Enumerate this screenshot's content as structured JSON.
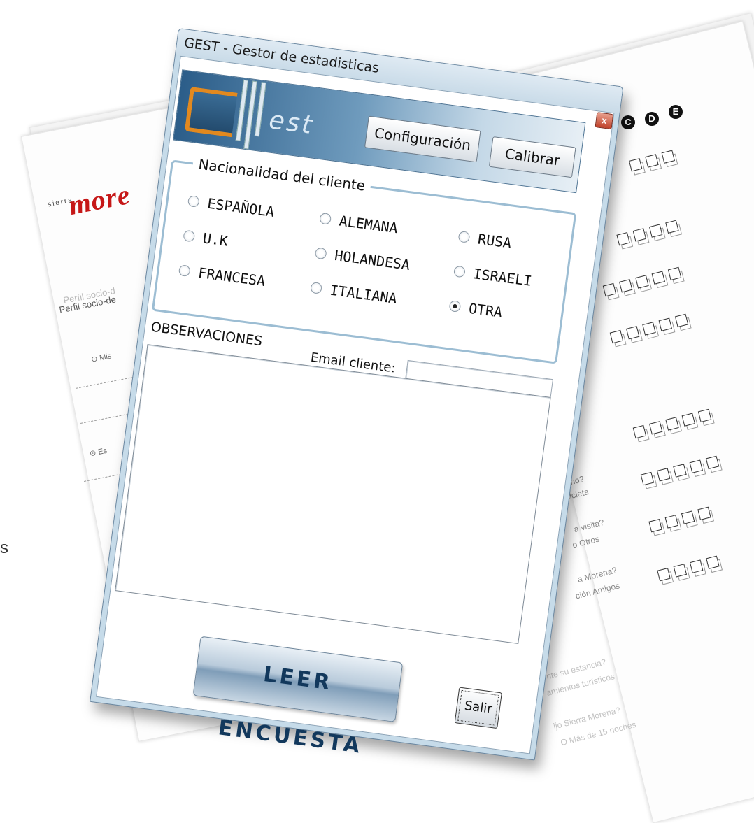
{
  "window": {
    "title": "GEST - Gestor de estadisticas",
    "close_glyph": "x"
  },
  "header": {
    "logo_text": "est",
    "config_label": "Configuración",
    "calibrate_label": "Calibrar"
  },
  "nationality": {
    "legend": "Nacionalidad del cliente",
    "options": [
      {
        "label": "ESPAÑOLA",
        "checked": false
      },
      {
        "label": "ALEMANA",
        "checked": false
      },
      {
        "label": "RUSA",
        "checked": false
      },
      {
        "label": "U.K",
        "checked": false
      },
      {
        "label": "HOLANDESA",
        "checked": false
      },
      {
        "label": "ISRAELI",
        "checked": false
      },
      {
        "label": "FRANCESA",
        "checked": false
      },
      {
        "label": "ITALIANA",
        "checked": false
      },
      {
        "label": "OTRA",
        "checked": true
      }
    ]
  },
  "form": {
    "observations_label": "OBSERVACIONES",
    "email_label": "Email cliente:",
    "email_value": "",
    "observations_value": ""
  },
  "actions": {
    "read_survey_label": "LEER ENCUESTA",
    "exit_label": "Salir"
  },
  "background": {
    "brand_small": "sierra",
    "brand_word": "more",
    "profile_title": "Perfil socio-de",
    "profile_ghost": "Perfil socio-d",
    "option_a": "Mis",
    "option_b": "Es",
    "edge_letter": "s",
    "answer_letters": [
      "C",
      "D",
      "E"
    ],
    "question_fragments": [
      "no?",
      "cicleta",
      "a visita?",
      "o Otros",
      "a Morena?",
      "ción Amigos",
      "nte su estancia?",
      "amientos turísticos",
      "ijo Sierra Morena?",
      "O Más de 15 noches"
    ]
  }
}
